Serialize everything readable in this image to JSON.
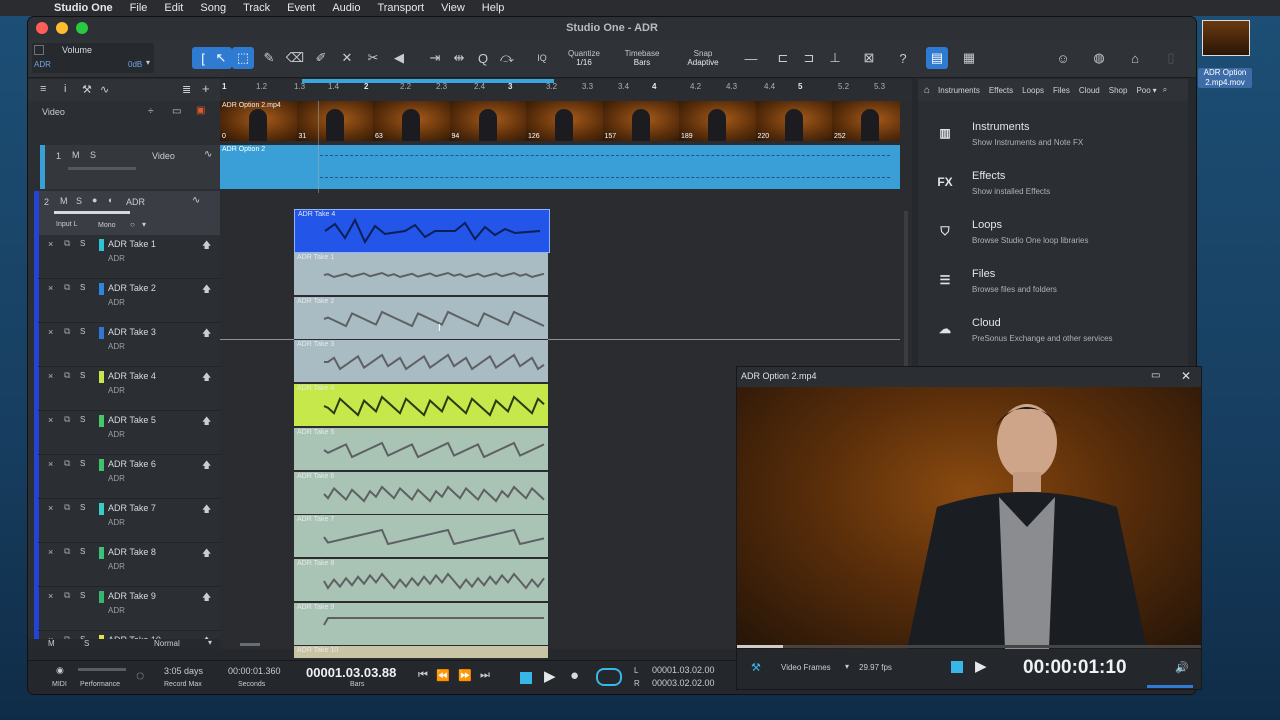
{
  "menubar": {
    "app": "Studio One",
    "items": [
      "File",
      "Edit",
      "Song",
      "Track",
      "Event",
      "Audio",
      "Transport",
      "View",
      "Help"
    ]
  },
  "window": {
    "title": "Studio One - ADR"
  },
  "toolbar": {
    "volume_label": "Volume",
    "volume_value": "0dB",
    "track_name": "ADR",
    "quantize_label": "Quantize",
    "quantize_value": "1/16",
    "timebase_label": "Timebase",
    "timebase_value": "Bars",
    "snap_label": "Snap",
    "snap_value": "Adaptive",
    "iq_label": "IQ"
  },
  "ruler": {
    "ticks": [
      "1",
      "1.2",
      "1.3",
      "1.4",
      "2",
      "2.2",
      "2.3",
      "2.4",
      "3",
      "3.2",
      "3.3",
      "3.4",
      "4",
      "4.2",
      "4.3",
      "4.4",
      "5",
      "5.2",
      "5.3"
    ]
  },
  "video_track": {
    "label": "Video",
    "clip_label": "ADR Option 2.mp4",
    "audio_clip_label": "ADR Option 2",
    "frame_numbers": [
      "0",
      "31",
      "63",
      "94",
      "126",
      "157",
      "189",
      "220",
      "252"
    ],
    "number": "1",
    "m": "M",
    "s": "S",
    "name": "Video"
  },
  "adr_track": {
    "number": "2",
    "m": "M",
    "s": "S",
    "name": "ADR",
    "input": "Input L",
    "mode": "Mono",
    "clip_label": "ADR Take 4"
  },
  "takes": [
    {
      "name": "ADR Take 1",
      "sub": "ADR",
      "color": "#2fc3d6",
      "clip": "ADR Take 1"
    },
    {
      "name": "ADR Take 2",
      "sub": "ADR",
      "color": "#2e86de",
      "clip": "ADR Take 2"
    },
    {
      "name": "ADR Take 3",
      "sub": "ADR",
      "color": "#2e78d6",
      "clip": "ADR Take 3"
    },
    {
      "name": "ADR Take 4",
      "sub": "ADR",
      "color": "#c6e84a",
      "clip": "ADR Take 4"
    },
    {
      "name": "ADR Take 5",
      "sub": "ADR",
      "color": "#45c86a",
      "clip": "ADR Take 5"
    },
    {
      "name": "ADR Take 6",
      "sub": "ADR",
      "color": "#3ec26a",
      "clip": "ADR Take 6"
    },
    {
      "name": "ADR Take 7",
      "sub": "ADR",
      "color": "#38cfc3",
      "clip": "ADR Take 7"
    },
    {
      "name": "ADR Take 8",
      "sub": "ADR",
      "color": "#3cc07a",
      "clip": "ADR Take 8"
    },
    {
      "name": "ADR Take 9",
      "sub": "ADR",
      "color": "#35b86e",
      "clip": "ADR Take 9"
    },
    {
      "name": "ADR Take 10",
      "sub": "",
      "color": "#e6e04a",
      "clip": "ADR Take 10"
    }
  ],
  "takes_controls": {
    "x": "×",
    "s": "S"
  },
  "leftfoot": {
    "m": "M",
    "s": "S",
    "mode": "Normal"
  },
  "browser": {
    "tabs": [
      "Instruments",
      "Effects",
      "Loops",
      "Files",
      "Cloud",
      "Shop",
      "Poo"
    ],
    "items": [
      {
        "title": "Instruments",
        "desc": "Show Instruments and Note FX",
        "icon": "piano-icon"
      },
      {
        "title": "Effects",
        "desc": "Show installed Effects",
        "icon": "fx-icon"
      },
      {
        "title": "Loops",
        "desc": "Browse Studio One loop libraries",
        "icon": "loops-icon"
      },
      {
        "title": "Files",
        "desc": "Browse files and folders",
        "icon": "files-icon"
      },
      {
        "title": "Cloud",
        "desc": "PreSonus Exchange and other services",
        "icon": "cloud-icon"
      }
    ],
    "fx_glyph": "FX"
  },
  "video_window": {
    "title": "ADR Option 2.mp4",
    "frames_label": "Video Frames",
    "fps": "29.97 fps",
    "timecode": "00:00:01:10",
    "progress": 0.1
  },
  "transport": {
    "midi": "MIDI",
    "performance": "Performance",
    "record_days": "3:05 days",
    "record_max": "Record Max",
    "seconds_value": "00:00:01.360",
    "seconds_label": "Seconds",
    "bars_value": "00001.03.03.88",
    "bars_label": "Bars",
    "loop_l": "00001.03.02.00",
    "loop_r": "00003.02.02.00",
    "l": "L",
    "r": "R"
  },
  "desktop_file": {
    "name": "ADR Option 2.mp4.mov"
  },
  "colors": {
    "accent": "#2f7bd2",
    "video_track": "#3a9fd6",
    "selected_clip": "#2255e8",
    "take_clip": "#a9bcc4",
    "take4_clip": "#c6e84a"
  }
}
